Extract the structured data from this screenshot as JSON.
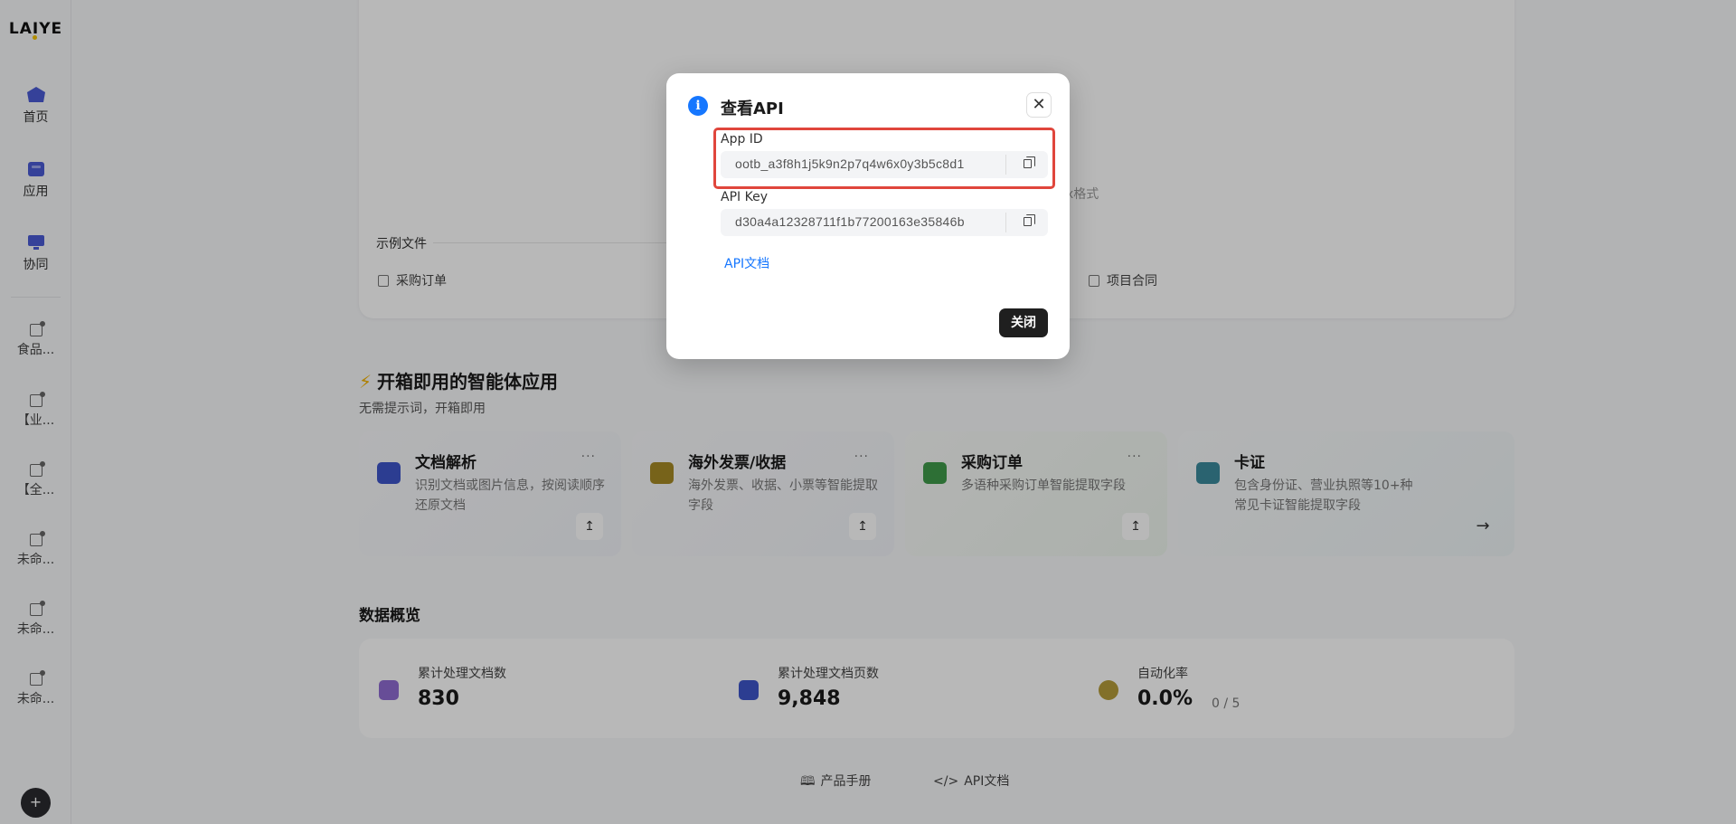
{
  "sidebar": {
    "logo": "LAIYE",
    "nav": [
      {
        "label": "首页",
        "icon": "home-icon"
      },
      {
        "label": "应用",
        "icon": "apps-icon"
      },
      {
        "label": "协同",
        "icon": "collaborate-icon"
      }
    ],
    "apps": [
      {
        "label": "食品..."
      },
      {
        "label": "【业..."
      },
      {
        "label": "【全..."
      },
      {
        "label": "未命..."
      },
      {
        "label": "未命..."
      },
      {
        "label": "未命..."
      }
    ],
    "add_label": "+"
  },
  "upload": {
    "faded_hint": "x格式",
    "samples_label": "示例文件",
    "samples": [
      "采购订单",
      "项目合同"
    ]
  },
  "agents_section": {
    "title": "开箱即用的智能体应用",
    "subtitle": "无需提示词，开箱即用",
    "cards": [
      {
        "title": "文档解析",
        "desc": "识别文档或图片信息，按阅读顺序还原文档",
        "more": "...",
        "action": "↥"
      },
      {
        "title": "海外发票/收据",
        "desc": "海外发票、收据、小票等智能提取字段",
        "more": "...",
        "action": "↥"
      },
      {
        "title": "采购订单",
        "desc": "多语种采购订单智能提取字段",
        "more": "...",
        "action": "↥"
      },
      {
        "title": "卡证",
        "desc": "包含身份证、营业执照等10+种常见卡证智能提取字段",
        "action": "→"
      }
    ]
  },
  "overview": {
    "title": "数据概览",
    "stats": [
      {
        "label": "累计处理文档数",
        "value": "830"
      },
      {
        "label": "累计处理文档页数",
        "value": "9,848"
      },
      {
        "label": "自动化率",
        "value": "0.0%",
        "extra": "0 / 5"
      }
    ]
  },
  "footer": {
    "manual": "产品手册",
    "api_docs": "API文档"
  },
  "modal": {
    "title": "查看API",
    "close_glyph": "✕",
    "app_id_label": "App ID",
    "app_id_value": "ootb_a3f8h1j5k9n2p7q4w6x0y3b5c8d1",
    "api_key_label": "API Key",
    "api_key_value": "d30a4a12328711f1b77200163e35846b",
    "api_doc_link": "API文档",
    "close_button": "关闭"
  },
  "colors": {
    "accent_blue": "#1677ff",
    "highlight_red": "#e0463c",
    "primary_dark": "#1f1f1f"
  }
}
